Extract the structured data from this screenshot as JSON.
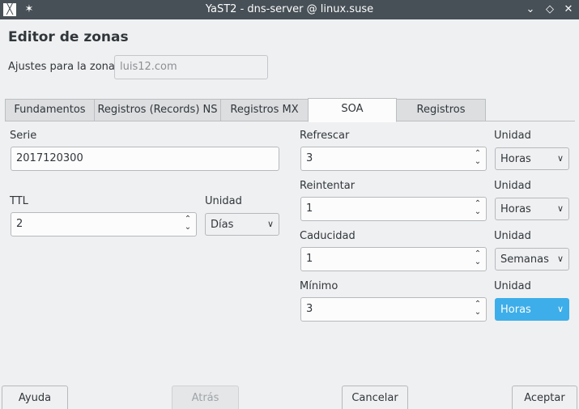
{
  "window": {
    "title": "YaST2 - dns-server @ linux.suse",
    "app_icon_glyph": "╳",
    "pin_glyph": "✶",
    "minimize_glyph": "⌄",
    "maximize_glyph": "◇",
    "close_glyph": "✕"
  },
  "heading": "Editor de zonas",
  "zone": {
    "label": "Ajustes para la zona",
    "value": "luis12.com"
  },
  "tabs": [
    {
      "label": "Fundamentos",
      "active": false
    },
    {
      "label": "Registros (Records) NS",
      "active": false
    },
    {
      "label": "Registros MX",
      "active": false
    },
    {
      "label": "SOA",
      "active": true
    },
    {
      "label": "Registros",
      "active": false
    }
  ],
  "soa": {
    "serie_label": "Serie",
    "serie_value": "2017120300",
    "ttl_label": "TTL",
    "ttl_value": "2",
    "ttl_unit_label": "Unidad",
    "ttl_unit_value": "Días",
    "refrescar_label": "Refrescar",
    "refrescar_value": "3",
    "refrescar_unit_label": "Unidad",
    "refrescar_unit_value": "Horas",
    "reintentar_label": "Reintentar",
    "reintentar_value": "1",
    "reintentar_unit_label": "Unidad",
    "reintentar_unit_value": "Horas",
    "caducidad_label": "Caducidad",
    "caducidad_value": "1",
    "caducidad_unit_label": "Unidad",
    "caducidad_unit_value": "Semanas",
    "minimo_label": "Mínimo",
    "minimo_value": "3",
    "minimo_unit_label": "Unidad",
    "minimo_unit_value": "Horas"
  },
  "icons": {
    "spin_up": "⌃",
    "spin_down": "⌄",
    "caret": "∨"
  },
  "buttons": {
    "help": "Ayuda",
    "back": "Atrás",
    "cancel": "Cancelar",
    "accept": "Aceptar"
  },
  "colors": {
    "titlebar": "#475057",
    "window_bg": "#eff0f1",
    "accent": "#3daee9"
  }
}
